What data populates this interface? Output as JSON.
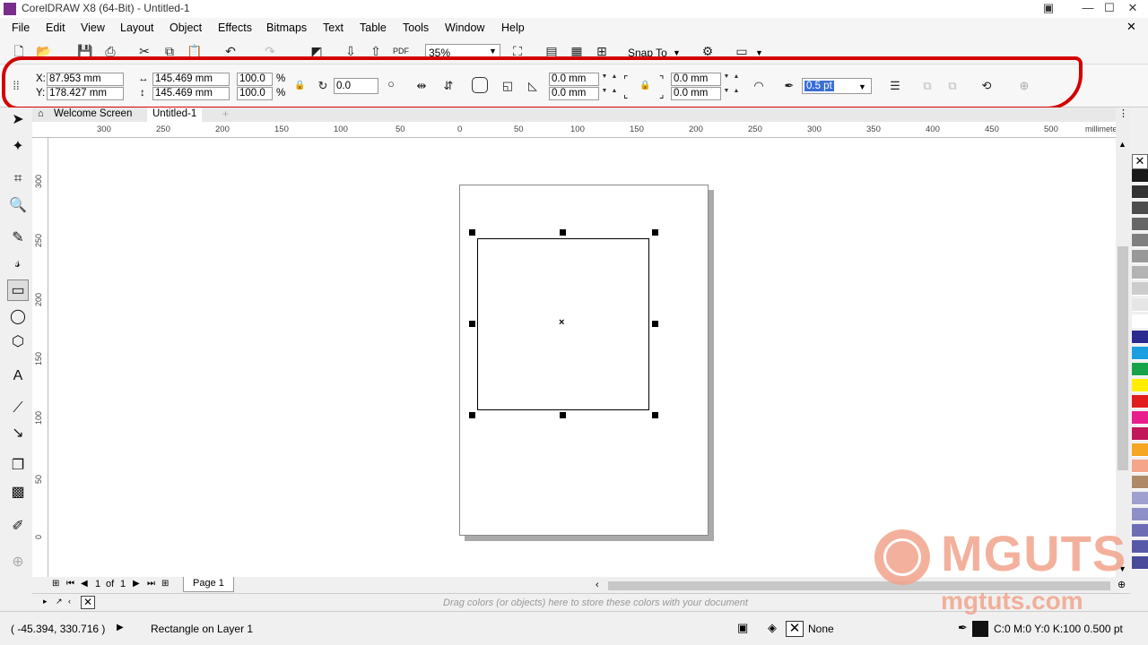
{
  "window": {
    "title": "CorelDRAW X8 (64-Bit) - Untitled-1"
  },
  "menu": [
    "File",
    "Edit",
    "View",
    "Layout",
    "Object",
    "Effects",
    "Bitmaps",
    "Text",
    "Table",
    "Tools",
    "Window",
    "Help"
  ],
  "toolbar": {
    "zoom": "35%",
    "snap_to": "Snap To"
  },
  "props": {
    "x_label": "X:",
    "x_value": "87.953 mm",
    "y_label": "Y:",
    "y_value": "178.427 mm",
    "width": "145.469 mm",
    "height": "145.469 mm",
    "scale_x": "100.0",
    "scale_y": "100.0",
    "pct": "%",
    "rotation": "0.0",
    "corner1": "0.0 mm",
    "corner2": "0.0 mm",
    "corner3": "0.0 mm",
    "corner4": "0.0 mm",
    "outline": "0.5 pt"
  },
  "tabs": [
    "Welcome Screen",
    "Untitled-1"
  ],
  "ruler": {
    "units": "millimeters",
    "h_ticks": [
      "300",
      "250",
      "200",
      "150",
      "100",
      "50",
      "0",
      "50",
      "100",
      "150",
      "200",
      "250",
      "300",
      "350",
      "400",
      "450",
      "500"
    ],
    "v_ticks": [
      "300",
      "250",
      "200",
      "150",
      "100",
      "50",
      "0"
    ]
  },
  "pagenav": {
    "current": "1",
    "of": "of",
    "total": "1",
    "page_tab": "Page 1"
  },
  "docpalette": {
    "hint": "Drag colors (or objects) here to store these colors with your document"
  },
  "status": {
    "coords": "( -45.394, 330.716 )",
    "object": "Rectangle on Layer 1",
    "fill": "None",
    "outline": "C:0 M:0 Y:0 K:100  0.500 pt"
  },
  "watermark": {
    "brand": "MGUTS",
    "url": "mgtuts.com"
  },
  "palette_colors": [
    "#1a1a1a",
    "#333333",
    "#4d4d4d",
    "#666666",
    "#808080",
    "#999999",
    "#b3b3b3",
    "#cccccc",
    "#e6e6e6",
    "#ffffff",
    "#2b2a8f",
    "#1aa0e0",
    "#16a34a",
    "#ffee00",
    "#e11d1d",
    "#e81e8c",
    "#c2185b",
    "#f5a623",
    "#f4a58a",
    "#b08968",
    "#a0a0d0",
    "#8e8ec8",
    "#6d6db5",
    "#5858a8",
    "#4a4a9a"
  ]
}
